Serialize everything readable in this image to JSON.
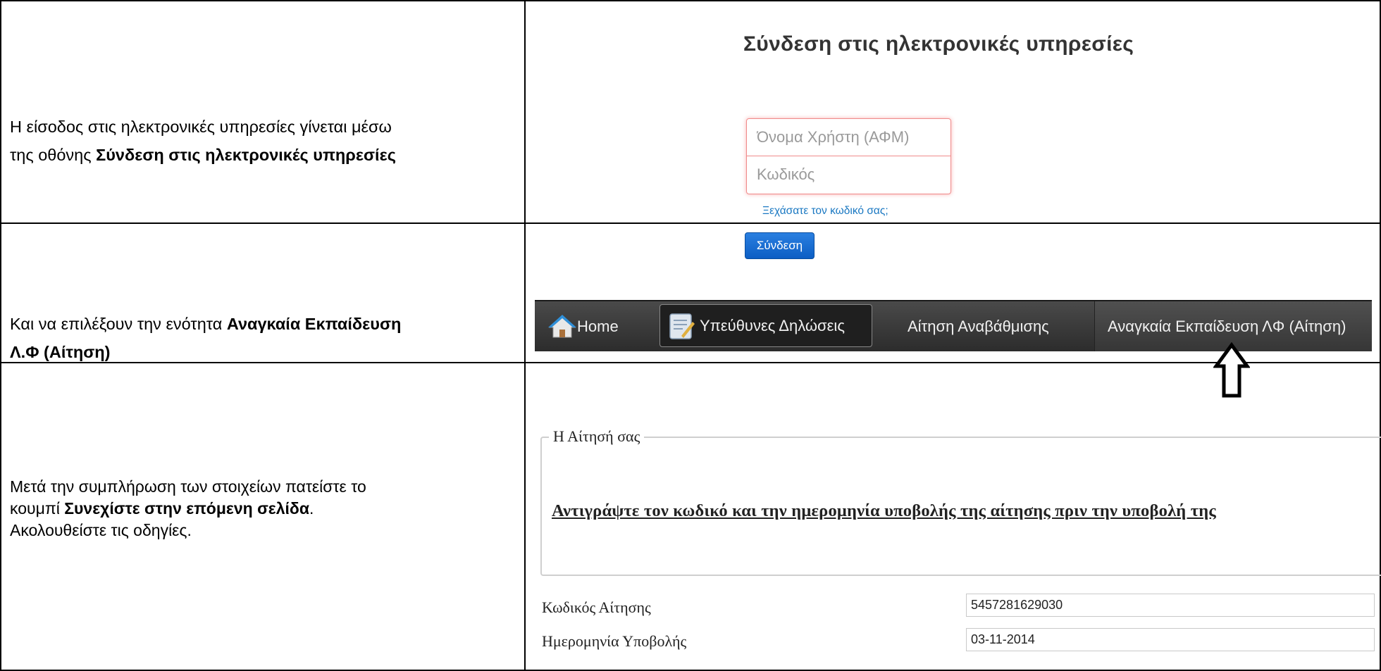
{
  "rows": [
    {
      "instruction": {
        "line1": "Η είσοδος στις ηλεκτρονικές υπηρεσίες γίνεται μέσω",
        "line2_prefix": "της οθόνης ",
        "line2_bold": "Σύνδεση στις ηλεκτρονικές υπηρεσίες"
      }
    },
    {
      "instruction": {
        "prefix": "Και να επιλέξουν την ενότητα ",
        "bold_line1": "Αναγκαία Εκπαίδευση",
        "bold_line2": "Λ.Φ (Αίτηση)"
      }
    },
    {
      "instruction": {
        "line1": "Μετά την συμπλήρωση των στοιχείων πατείστε το",
        "line2_prefix": "κουμπί ",
        "line2_bold": "Συνεχίστε στην επόμενη σελίδα",
        "line2_suffix": ".",
        "line3": "Ακολουθείστε τις οδηγίες."
      }
    }
  ],
  "login": {
    "title": "Σύνδεση στις ηλεκτρονικές υπηρεσίες",
    "username_placeholder": "Όνομα Χρήστη (ΑΦΜ)",
    "password_placeholder": "Κωδικός",
    "forgot_link": "Ξεχάσατε τον κωδικό σας;",
    "submit_label": "Σύνδεση",
    "accent_color": "#0c5ec4"
  },
  "nav": {
    "items": [
      {
        "label": "Home",
        "icon": "home-icon"
      },
      {
        "label": "Υπεύθυνες Δηλώσεις",
        "icon": "declarations-icon",
        "active": true
      },
      {
        "label": "Αίτηση Αναβάθμισης"
      },
      {
        "label": "Αναγκαία Εκπαίδευση ΛΦ (Αίτηση)",
        "highlighted": true
      }
    ],
    "annotation_icon": "arrow-up-icon"
  },
  "application": {
    "legend": "Η Αίτησή σας",
    "warning": "Αντιγράψτε τον κωδικό και την ημερομηνία υποβολής της αίτησης πριν την υποβολή της",
    "fields": [
      {
        "label": "Κωδικός Αίτησης",
        "value": "5457281629030"
      },
      {
        "label": "Ημερομηνία Υποβολής",
        "value": "03-11-2014"
      }
    ]
  }
}
